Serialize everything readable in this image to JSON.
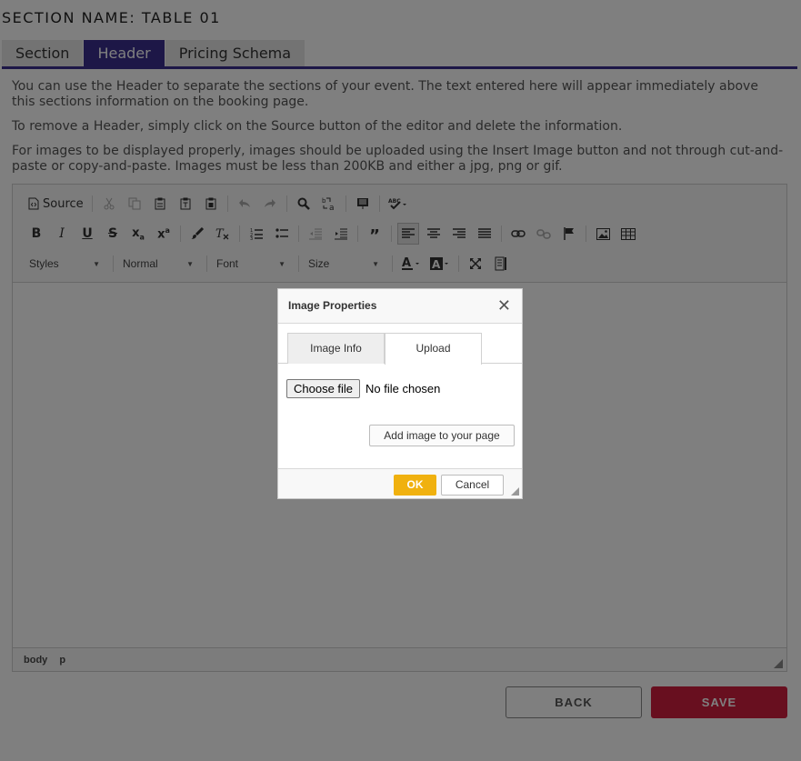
{
  "section": {
    "title": "SECTION NAME: TABLE 01"
  },
  "tabs": [
    {
      "label": "Section",
      "active": false
    },
    {
      "label": "Header",
      "active": true
    },
    {
      "label": "Pricing Schema",
      "active": false
    }
  ],
  "info": {
    "p1": "You can use the Header to separate the sections of your event. The text entered here will appear immediately above this sections information on the booking page.",
    "p2": "To remove a Header, simply click on the Source button of the editor and delete the information.",
    "p3": "For images to be displayed properly, images should be uploaded using the Insert Image button and not through cut-and-paste or copy-and-paste. Images must be less than 200KB and either a jpg, png or gif."
  },
  "editor": {
    "toolbar": {
      "source_label": "Source",
      "styles_label": "Styles",
      "format_label": "Normal",
      "font_label": "Font",
      "size_label": "Size"
    },
    "path": [
      "body",
      "p"
    ]
  },
  "actions": {
    "back_label": "BACK",
    "save_label": "SAVE"
  },
  "dialog": {
    "title": "Image Properties",
    "close_symbol": "✕",
    "tabs": [
      {
        "label": "Image Info",
        "active": false
      },
      {
        "label": "Upload",
        "active": true
      }
    ],
    "choose_file_label": "Choose file",
    "no_file_text": "No file chosen",
    "add_image_label": "Add image to your page",
    "ok_label": "OK",
    "cancel_label": "Cancel"
  },
  "colors": {
    "accent": "#3b2f8f",
    "save": "#d11f3f",
    "ok": "#f0b10f"
  }
}
